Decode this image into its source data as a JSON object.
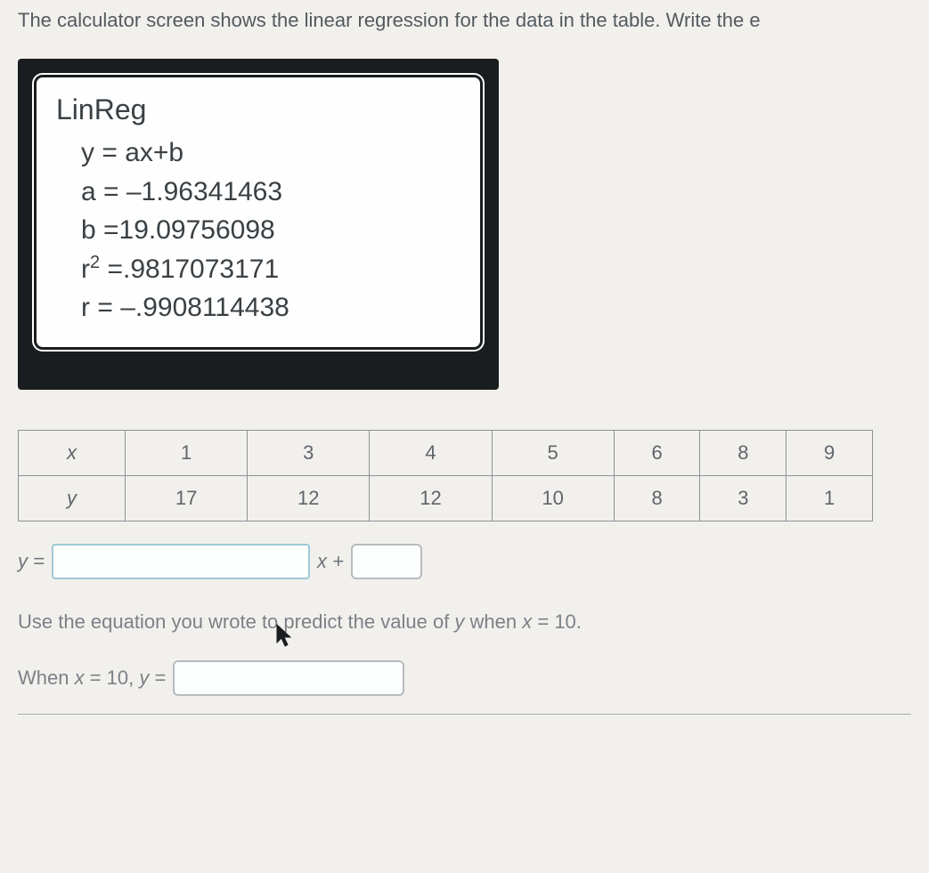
{
  "instruction": "The calculator screen shows the linear regression for the data in the table. Write the e",
  "calc": {
    "title": "LinReg",
    "model": "y = ax+b",
    "a_label": "a = ",
    "a_value": "–1.96341463",
    "b_label": "b =",
    "b_value": "19.09756098",
    "r2_label_pre": "r",
    "r2_label_post": " =",
    "r2_value": ".9817073171",
    "r_label": "r  = ",
    "r_value": "–.9908114438"
  },
  "table": {
    "row1_header": "x",
    "row1": [
      "1",
      "3",
      "4",
      "5",
      "6",
      "8",
      "9"
    ],
    "row2_header": "y",
    "row2": [
      "17",
      "12",
      "12",
      "10",
      "8",
      "3",
      "1"
    ]
  },
  "equation": {
    "y_equals": "y =",
    "x_plus": "x  +"
  },
  "predict": {
    "text_pre": "Use the equation you wrote to predict the value of ",
    "y_var": "y",
    "text_mid": " when ",
    "x_var": "x",
    "text_post": " = 10."
  },
  "when": {
    "pre": "When ",
    "x_var": "x",
    "eq10": " = 10, ",
    "y_var": "y",
    "eq": " ="
  }
}
